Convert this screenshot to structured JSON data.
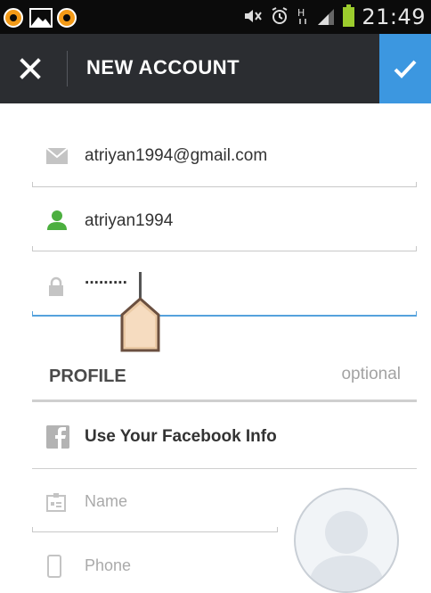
{
  "status_bar": {
    "time": "21:49"
  },
  "app_bar": {
    "title": "NEW ACCOUNT"
  },
  "form": {
    "email": {
      "value": "atriyan1994@gmail.com"
    },
    "username": {
      "value": "atriyan1994"
    },
    "password": {
      "value": "·········"
    }
  },
  "profile": {
    "heading": "PROFILE",
    "optional_label": "optional",
    "facebook_label": "Use Your Facebook Info",
    "name_placeholder": "Name",
    "phone_placeholder": "Phone"
  },
  "colors": {
    "accent": "#3c97e0",
    "appbar": "#2b2d31",
    "user_icon": "#4caf3f",
    "battery": "#9ccc2d"
  }
}
